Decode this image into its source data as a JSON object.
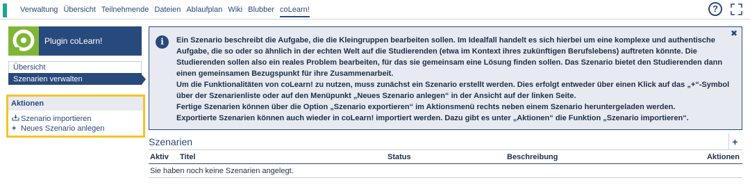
{
  "nav": {
    "tabs": [
      "Verwaltung",
      "Übersicht",
      "Teilnehmende",
      "Dateien",
      "Ablaufplan",
      "Wiki",
      "Blubber",
      "coLearn!"
    ],
    "active_tab": "coLearn!",
    "help_label": "?"
  },
  "plugin": {
    "title": "Plugin coLearn!"
  },
  "sidebar": {
    "items": [
      {
        "label": "Übersicht"
      },
      {
        "label": "Szenarien verwalten"
      }
    ]
  },
  "actions": {
    "title": "Aktionen",
    "items": [
      {
        "label": "Szenario importieren",
        "icon": "import-icon"
      },
      {
        "label": "Neues Szenario anlegen",
        "icon": "plus-icon"
      }
    ]
  },
  "info": {
    "paragraphs": [
      "Ein Szenario beschreibt die Aufgabe, die die Kleingruppen bearbeiten sollen. Im Idealfall handelt es sich hierbei um eine komplexe und authentische Aufgabe, die so oder so ähnlich in der echten Welt auf die Studierenden (etwa im Kontext ihres zukünftigen Berufslebens) auftreten könnte. Die Studierenden sollen also ein reales Problem bearbeiten, für das sie gemeinsam eine Lösung finden sollen. Das Szenario bietet den Studierenden dann einen gemeinsamen Bezugspunkt für ihre Zusammenarbeit.",
      "Um die Funktionalitäten von coLearn! zu nutzen, muss zunächst ein Szenario erstellt werden. Dies erfolgt entweder über einen Klick auf das „+“-Symbol über der Szenarienliste oder auf den Menüpunkt „Neues Szenario anlegen“ in der Ansicht auf der linken Seite.",
      "Fertige Szenarien können über die Option „Szenario exportieren“ im Aktionsmenü rechts neben einem Szenario heruntergeladen werden.",
      "Exportierte Szenarien können auch wieder in coLearn! importiert werden. Dazu gibt es unter „Aktionen“ die Funktion „Szenario importieren“."
    ]
  },
  "table": {
    "title": "Szenarien",
    "columns": {
      "aktiv": "Aktiv",
      "titel": "Titel",
      "status": "Status",
      "beschreibung": "Beschreibung",
      "aktionen": "Aktionen"
    },
    "empty_text": "Sie haben noch keine Szenarien angelegt."
  },
  "colors": {
    "primary": "#28497c",
    "accent_green": "#7fb635",
    "highlight": "#f7c227",
    "info_bg": "#e7ebf1"
  }
}
